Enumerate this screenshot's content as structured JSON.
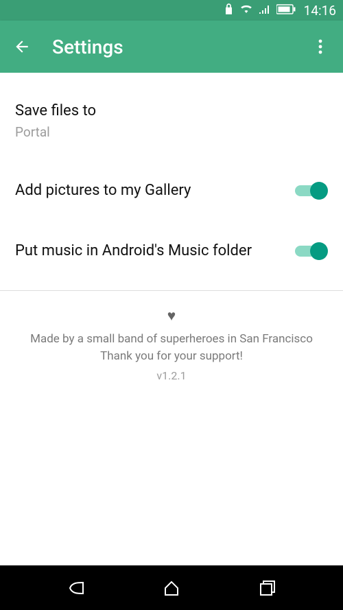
{
  "status": {
    "time": "14:16"
  },
  "header": {
    "title": "Settings"
  },
  "saveFiles": {
    "label": "Save files to",
    "value": "Portal"
  },
  "addPictures": {
    "label": "Add pictures to my Gallery",
    "on": true
  },
  "putMusic": {
    "label": "Put music in Android's Music folder",
    "on": true
  },
  "footer": {
    "line1": "Made by a small band of superheroes in San Francisco",
    "line2": "Thank you for your support!",
    "version": "v1.2.1"
  },
  "colors": {
    "accent": "#059b82",
    "appbar": "#42ad82",
    "statusbar": "#3a9e75"
  }
}
